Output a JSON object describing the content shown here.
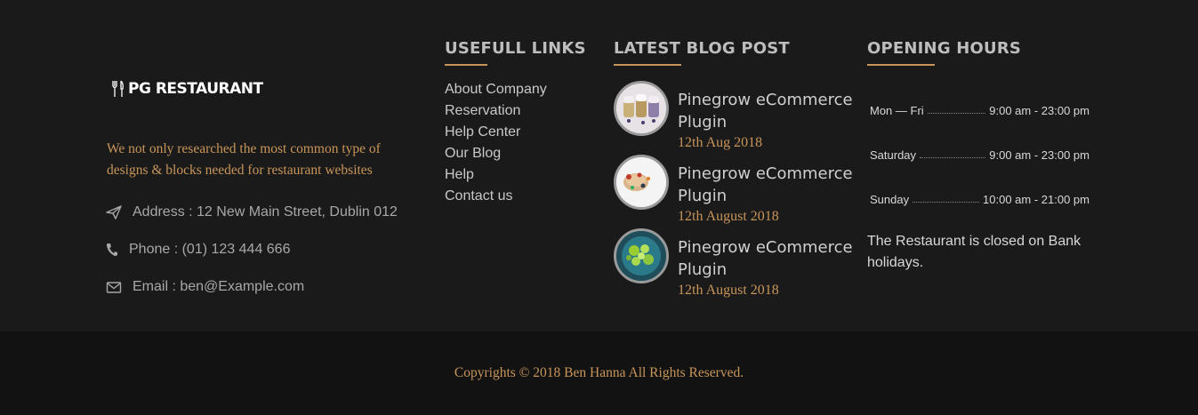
{
  "brand": {
    "logo_text": "PG RESTAURANT"
  },
  "about": {
    "text": "We not only researched the most common type of designs & blocks needed for restaurant websites",
    "address": "Address : 12 New Main Street, Dublin 012",
    "phone": "Phone : (01) 123 444 666",
    "email": "Email : ben@Example.com"
  },
  "links": {
    "heading": "USEFULL LINKS",
    "items": [
      "About Company",
      "Reservation",
      "Help Center",
      "Our Blog",
      "Help",
      "Contact us"
    ]
  },
  "blog": {
    "heading": "LATEST BLOG POST",
    "posts": [
      {
        "title": "Pinegrow eCommerce Plugin",
        "date": "12th Aug 2018"
      },
      {
        "title": "Pinegrow eCommerce Plugin",
        "date": "12th August 2018"
      },
      {
        "title": "Pinegrow eCommerce Plugin",
        "date": "12th August 2018"
      }
    ]
  },
  "hours": {
    "heading": "OPENING HOURS",
    "rows": [
      {
        "day": "Mon — Fri",
        "time": "9:00 am - 23:00 pm"
      },
      {
        "day": "Saturday",
        "time": "9:00 am - 23:00 pm"
      },
      {
        "day": "Sunday",
        "time": "10:00 am - 21:00 pm"
      }
    ],
    "note": "The Restaurant is closed on Bank holidays."
  },
  "footer": {
    "copyright": "Copyrights © 2018 Ben Hanna All Rights Reserved."
  },
  "colors": {
    "accent": "#c8955a",
    "background": "#1a1a1a",
    "bottom_bar": "#121212"
  },
  "icons": {
    "logo": "fork-knife-icon",
    "address": "paper-plane-icon",
    "phone": "phone-icon",
    "email": "envelope-icon"
  }
}
